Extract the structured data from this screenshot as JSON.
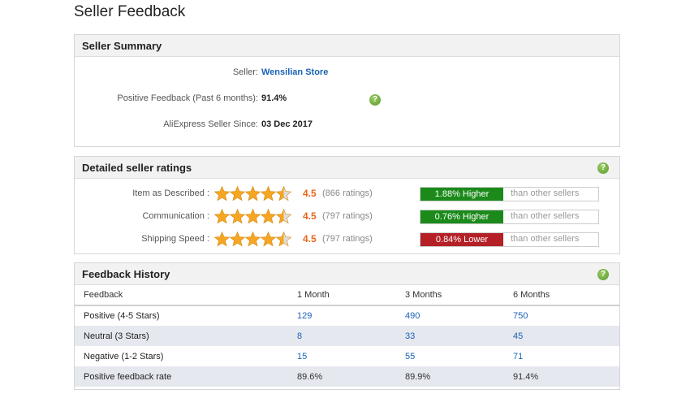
{
  "page": {
    "title": "Seller Feedback"
  },
  "summary": {
    "title": "Seller Summary",
    "seller_label": "Seller:",
    "seller_name": "Wensilian Store",
    "positive_label": "Positive Feedback (Past 6 months):",
    "positive_value": "91.4%",
    "since_label": "AliExpress Seller Since:",
    "since_value": "03 Dec 2017",
    "help_icon": "question-icon"
  },
  "ratings": {
    "title": "Detailed seller ratings",
    "rows": [
      {
        "label": "Item as Described :",
        "stars": 4.5,
        "score": "4.5",
        "count": "(866 ratings)",
        "badge": "1.88% Higher",
        "badge_type": "higher",
        "compare": "than other sellers"
      },
      {
        "label": "Communication :",
        "stars": 4.5,
        "score": "4.5",
        "count": "(797 ratings)",
        "badge": "0.76% Higher",
        "badge_type": "higher",
        "compare": "than other sellers"
      },
      {
        "label": "Shipping Speed :",
        "stars": 4.5,
        "score": "4.5",
        "count": "(797 ratings)",
        "badge": "0.84% Lower",
        "badge_type": "lower",
        "compare": "than other sellers"
      }
    ],
    "colors": {
      "higher": "#1b8a1b",
      "lower": "#b42026",
      "star": "#f5a623"
    }
  },
  "history": {
    "title": "Feedback History",
    "headers": [
      "Feedback",
      "1 Month",
      "3 Months",
      "6 Months"
    ],
    "rows": [
      {
        "label": "Positive (4-5 Stars)",
        "values": [
          "129",
          "490",
          "750"
        ]
      },
      {
        "label": "Neutral (3 Stars)",
        "values": [
          "8",
          "33",
          "45"
        ]
      },
      {
        "label": "Negative (1-2 Stars)",
        "values": [
          "15",
          "55",
          "71"
        ]
      },
      {
        "label": "Positive feedback rate",
        "values": [
          "89.6%",
          "89.9%",
          "91.4%"
        ]
      }
    ]
  }
}
